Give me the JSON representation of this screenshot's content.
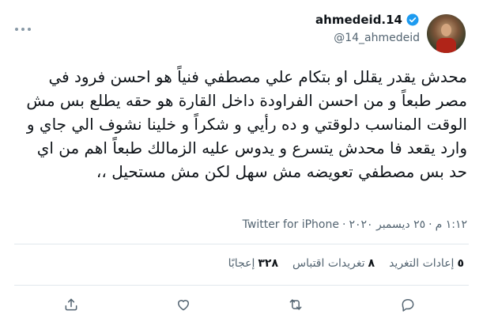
{
  "author": {
    "display_name": "ahmedeid.14",
    "handle": "@14_ahmedeid",
    "verified_icon": "verified-badge-icon"
  },
  "tweet": {
    "text": "محدش يقدر يقلل او بتكام علي مصطفي فنياً هو احسن فرود في مصر طبعاً و من احسن الفراودة داخل القارة هو حقه يطلع بس مش الوقت المناسب دلوقتي و ده رأيي و شكراً و خلينا نشوف الي جاي و وارد يقعد فا محدش يتسرع و يدوس عليه الزمالك طبعاً اهم من اي حد بس مصطفي تعويضه مش سهل لكن مش مستحيل ،،"
  },
  "meta": {
    "time": "١:١٢ م",
    "separator": "·",
    "date": "٢٥ ديسمبر ٢٠٢٠",
    "separator2": "·",
    "source": "Twitter for iPhone"
  },
  "stats": {
    "retweets_count": "٥",
    "retweets_label": "إعادات التغريد",
    "quotes_count": "٨",
    "quotes_label": "تغريدات اقتباس",
    "likes_count": "٣٢٨",
    "likes_label": "إعجابًا"
  },
  "colors": {
    "verified": "#1d9bf0",
    "secondary_text": "#536471",
    "divider": "#e1e8ed"
  },
  "icons": {
    "reply": "reply-icon",
    "retweet": "retweet-icon",
    "like": "heart-icon",
    "share": "share-icon",
    "more": "more-options-icon"
  }
}
